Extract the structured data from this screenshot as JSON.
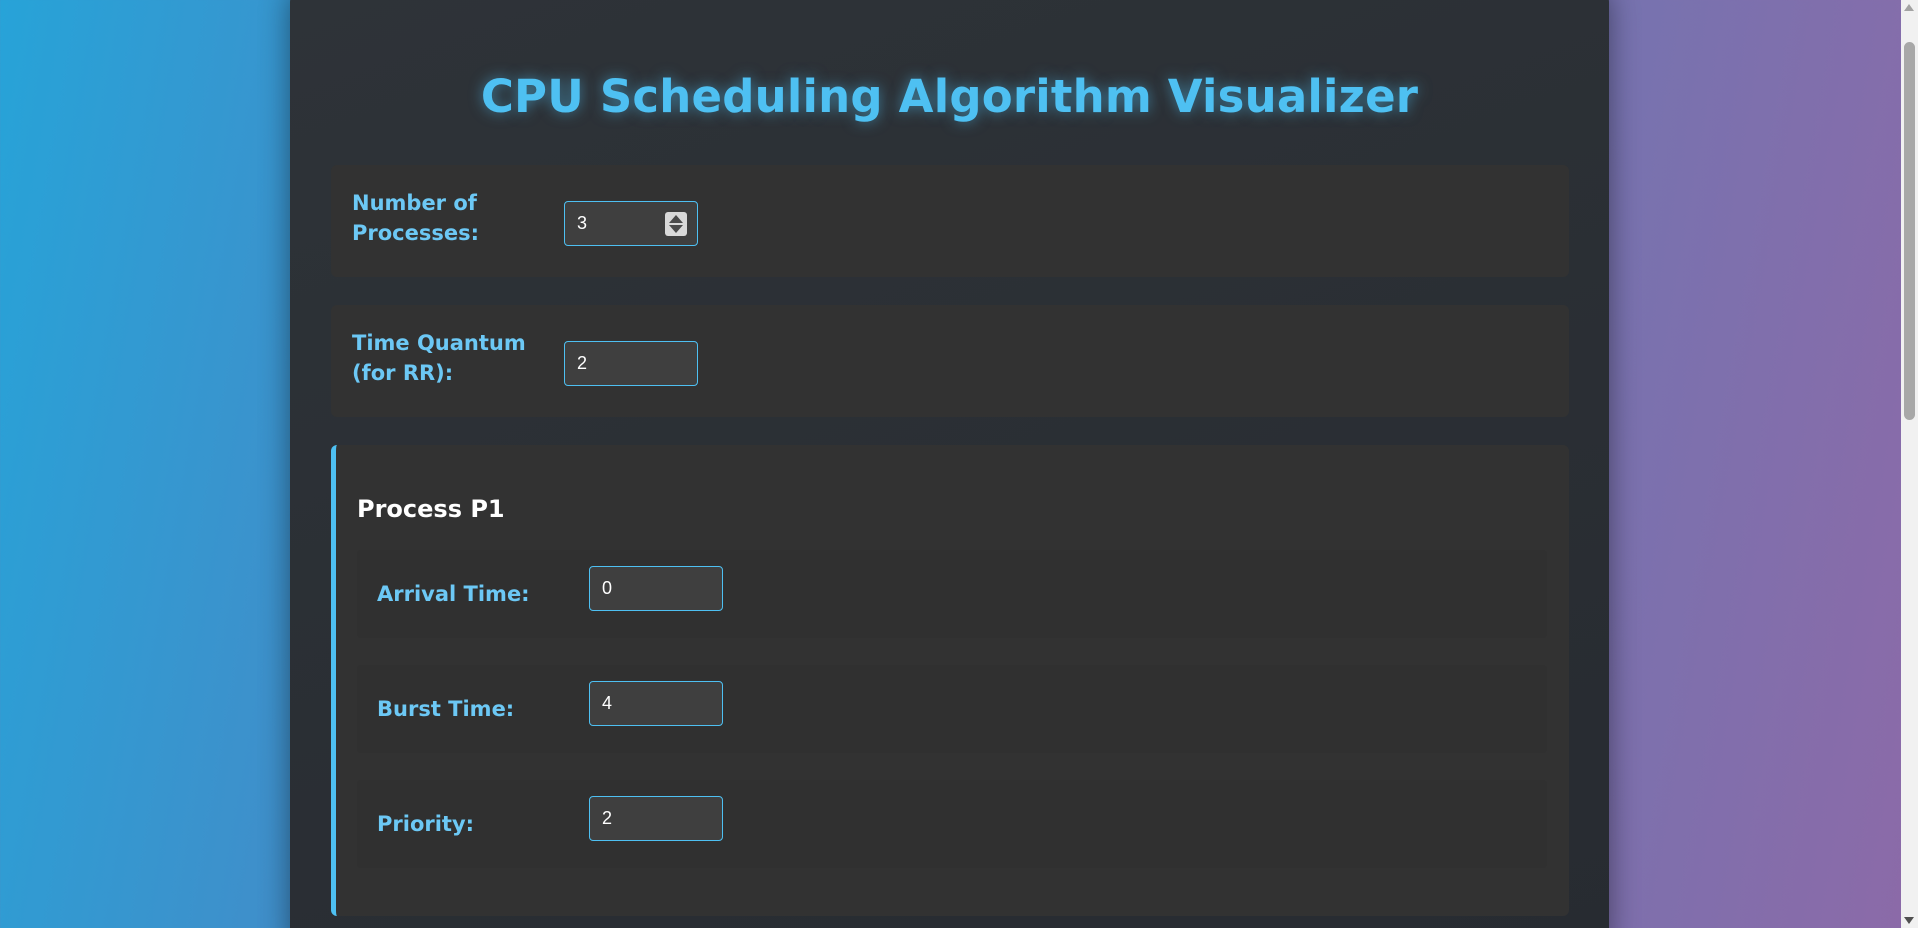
{
  "page": {
    "title": "CPU Scheduling Algorithm Visualizer"
  },
  "settings": {
    "num_processes_label": "Number of Processes:",
    "num_processes_value": "3",
    "time_quantum_label": "Time Quantum (for RR):",
    "time_quantum_value": "2"
  },
  "process": {
    "title": "Process P1",
    "fields": [
      {
        "label": "Arrival Time:",
        "value": "0"
      },
      {
        "label": "Burst Time:",
        "value": "4"
      },
      {
        "label": "Priority:",
        "value": "2"
      }
    ]
  },
  "colors": {
    "accent": "#4ec0f2",
    "panel": "#323232",
    "container": "#2b2f34"
  }
}
